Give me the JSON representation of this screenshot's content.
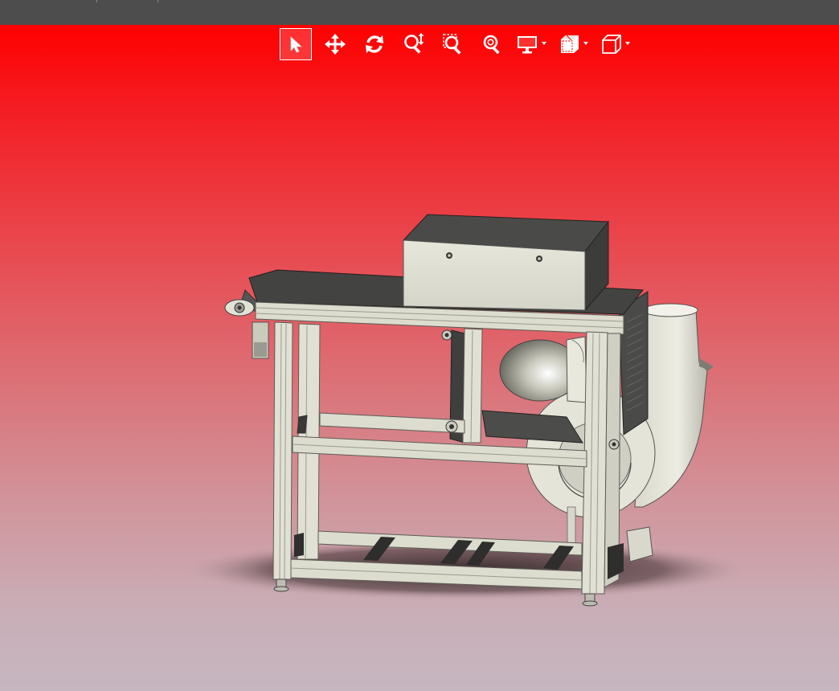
{
  "toolbar": {
    "tools": [
      {
        "id": "select",
        "icon": "select-arrow-icon",
        "active": true
      },
      {
        "id": "pan",
        "icon": "move-arrows-icon",
        "active": false
      },
      {
        "id": "rotate",
        "icon": "rotate-icon",
        "active": false
      },
      {
        "id": "zoom-dynamic",
        "icon": "zoom-dynamic-icon",
        "active": false
      },
      {
        "id": "zoom-area",
        "icon": "zoom-area-icon",
        "active": false
      },
      {
        "id": "zoom-fit",
        "icon": "zoom-fit-icon",
        "active": false
      },
      {
        "id": "display-mode",
        "icon": "monitor-icon",
        "dropdown": true
      },
      {
        "id": "section-view",
        "icon": "section-view-icon",
        "dropdown": true
      },
      {
        "id": "view-orientation",
        "icon": "cube-icon",
        "dropdown": true
      }
    ]
  },
  "colors": {
    "accent_top": "#ff0000",
    "background_bottom": "#c6b6bf",
    "frame_metal": "#dcdccf",
    "belt_dark": "#3f3f3f",
    "housing": "#e2e2d6"
  },
  "viewport": {
    "model": "conveyor-with-centrifugal-blower"
  }
}
